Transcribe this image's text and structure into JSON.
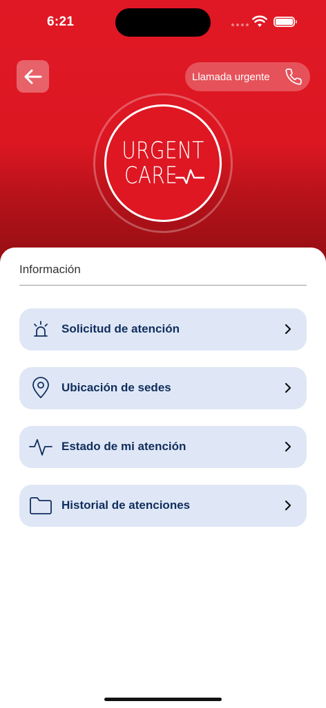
{
  "status_bar": {
    "time": "6:21"
  },
  "header": {
    "urgent_call_label": "Llamada urgente",
    "logo_line1": "URGENT",
    "logo_line2": "CARE"
  },
  "info": {
    "section_title": "Información",
    "items": [
      {
        "label": "Solicitud de atención",
        "icon": "siren-icon"
      },
      {
        "label": "Ubicación de sedes",
        "icon": "location-pin-icon"
      },
      {
        "label": "Estado de mi atención",
        "icon": "pulse-icon"
      },
      {
        "label": "Historial de atenciones",
        "icon": "folder-icon"
      }
    ]
  },
  "colors": {
    "brand_red": "#dc1722",
    "item_bg": "#dfe7f6",
    "item_text": "#102d5c"
  }
}
